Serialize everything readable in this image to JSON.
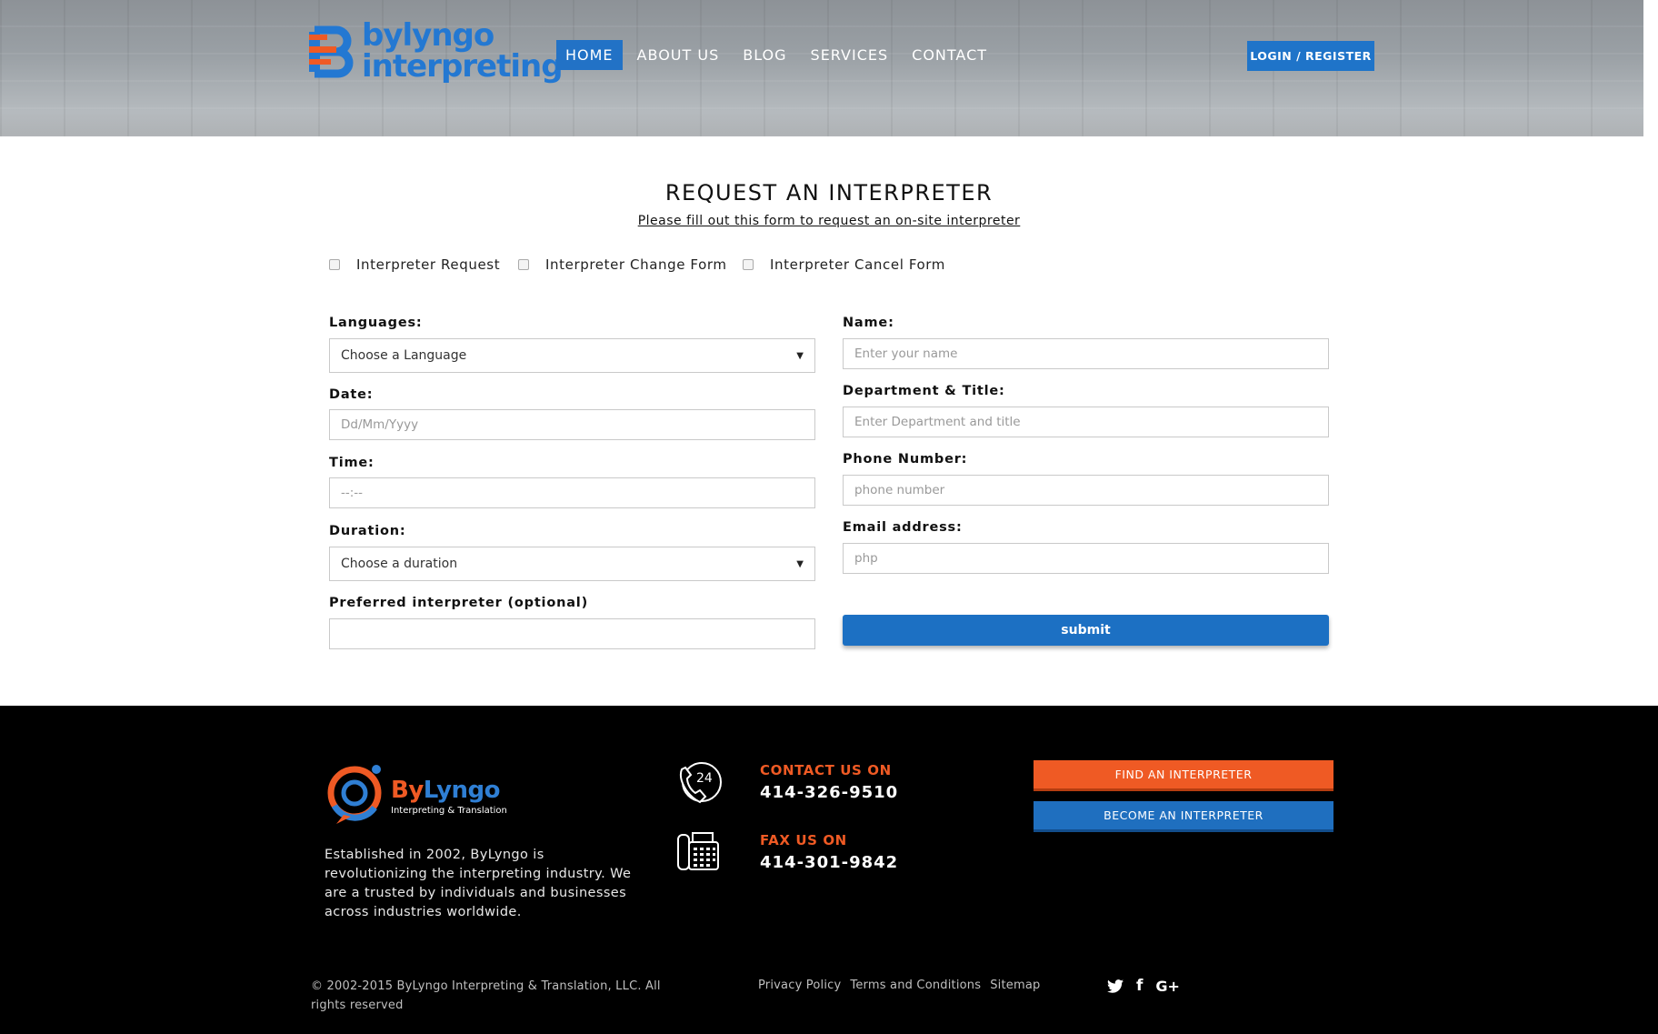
{
  "header": {
    "logo_line1": "bylyngo",
    "logo_line2": "interpreting",
    "nav": [
      {
        "label": "HOME",
        "active": true
      },
      {
        "label": "ABOUT US"
      },
      {
        "label": "BLOG"
      },
      {
        "label": "SERVICES"
      },
      {
        "label": "CONTACT"
      }
    ],
    "login_label": "LOGIN / REGISTER"
  },
  "form": {
    "title": "REQUEST AN INTERPRETER",
    "subtitle": "Please fill out this form to request an on-site interpreter",
    "types": [
      "Interpreter Request",
      "Interpreter Change Form",
      "Interpreter Cancel Form"
    ],
    "left": {
      "languages_label": "Languages:",
      "languages_value": "Choose a Language",
      "date_label": "Date:",
      "date_placeholder": "Dd/Mm/Yyyy",
      "time_label": "Time:",
      "time_placeholder": "--:--",
      "duration_label": "Duration:",
      "duration_value": "Choose a duration",
      "preferred_label": "Preferred interpreter (optional)",
      "preferred_value": ""
    },
    "right": {
      "name_label": "Name:",
      "name_placeholder": "Enter your name",
      "dept_label": "Department & Title:",
      "dept_placeholder": "Enter Department and title",
      "phone_label": "Phone Number:",
      "phone_placeholder": "phone number",
      "email_label": "Email address:",
      "email_placeholder": "php"
    },
    "submit_label": "submit"
  },
  "footer": {
    "logo_by": "By",
    "logo_lyngo": "Lyngo",
    "logo_sub": "Interpreting & Translation",
    "about": "Established in 2002, ByLyngo is revolutionizing the interpreting industry. We are a trusted by individuals and businesses across industries worldwide.",
    "phone_badge": "24",
    "contact_heading": "CONTACT US ON",
    "contact_number": "414-326-9510",
    "fax_heading": "FAX US ON",
    "fax_number": "414-301-9842",
    "find_btn": "FIND AN INTERPRETER",
    "become_btn": "BECOME AN INTERPRETER",
    "copyright": "© 2002-2015 ByLyngo Interpreting & Translation, LLC. All rights reserved",
    "links": [
      "Privacy Policy",
      "Terms and Conditions",
      "Sitemap"
    ],
    "social": [
      {
        "icon": "twitter-icon",
        "glyph": "🐦"
      },
      {
        "icon": "facebook-icon",
        "glyph": "f"
      },
      {
        "icon": "google-plus-icon",
        "glyph": "G+"
      }
    ],
    "colors": {
      "orange": "#ef5a24",
      "blue": "#1f6fbf"
    }
  }
}
